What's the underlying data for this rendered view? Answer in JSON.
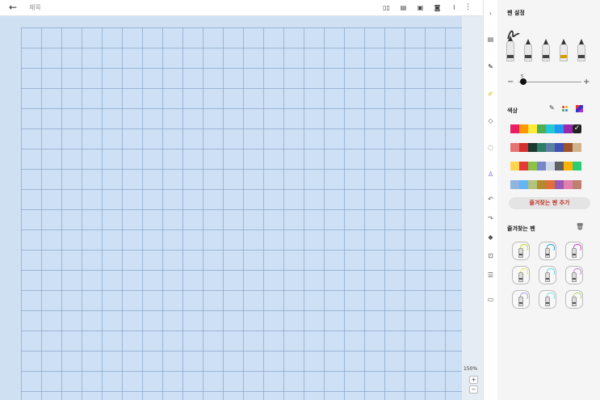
{
  "header": {
    "back_icon": "arrow-left-icon",
    "title_placeholder": "제목",
    "toolbar_icons": [
      "book-icon",
      "template-icon",
      "image-icon",
      "camera-icon",
      "attach-icon"
    ],
    "more_icon": "more-vertical-icon"
  },
  "canvas": {
    "zoom_label": "150%",
    "zoom_in": "+",
    "zoom_out": "−",
    "paper_color": "#cde0f5"
  },
  "tools": [
    {
      "name": "collapse-icon",
      "glyph": "›"
    },
    {
      "name": "layout-icon",
      "glyph": "▤"
    },
    {
      "name": "pen-icon",
      "glyph": "✎"
    },
    {
      "name": "highlighter-icon",
      "glyph": "✐"
    },
    {
      "name": "eraser-icon",
      "glyph": "◇"
    },
    {
      "name": "lasso-icon",
      "glyph": "◌"
    },
    {
      "name": "shape-recognize-icon",
      "glyph": "♙"
    },
    {
      "name": "undo-icon",
      "glyph": "↶"
    },
    {
      "name": "redo-icon",
      "glyph": "↷"
    },
    {
      "name": "shapes-icon",
      "glyph": "◆"
    },
    {
      "name": "text-box-icon",
      "glyph": "⊡"
    },
    {
      "name": "text-format-icon",
      "glyph": "☰"
    },
    {
      "name": "page-icon",
      "glyph": "▭"
    }
  ],
  "panel": {
    "title": "펜 설정",
    "pen_size": "5",
    "size_minus": "−",
    "size_plus": "+",
    "color_label": "색상",
    "colors": [
      [
        "#e91e63",
        "#ff9800",
        "#ffeb3b",
        "#4caf50",
        "#26c6da",
        "#2196f3",
        "#9c27b0",
        "#212121"
      ],
      [
        "#e57373",
        "#d32f2f",
        "#1b3a2f",
        "#2e7d66",
        "#5c7fa3",
        "#3f51b5",
        "#a0522d",
        "#d2b48c"
      ],
      [
        "#ffd54f",
        "#e53935",
        "#8bc34a",
        "#7986cb",
        "#d1d9e6",
        "#616161",
        "#ffb300",
        "#2ecc71"
      ],
      [
        "#90b4e0",
        "#64b5f6",
        "#b0c47a",
        "#b38b2e",
        "#e0703a",
        "#9b59b6",
        "#e07fb0",
        "#c08070"
      ]
    ],
    "selected_color": "#212121",
    "check_glyph": "✓",
    "add_favorite_label": "즐겨찾는 펜 추가",
    "favorites_label": "즐겨찾는 펜",
    "favorites_colors": [
      "#c6d82c",
      "#2ea0d8",
      "#c040c0",
      "#e8e86a",
      "#6ad0e8",
      "#c080d0",
      "#b0a0e0",
      "#80e0e0",
      "#b0d080"
    ]
  }
}
